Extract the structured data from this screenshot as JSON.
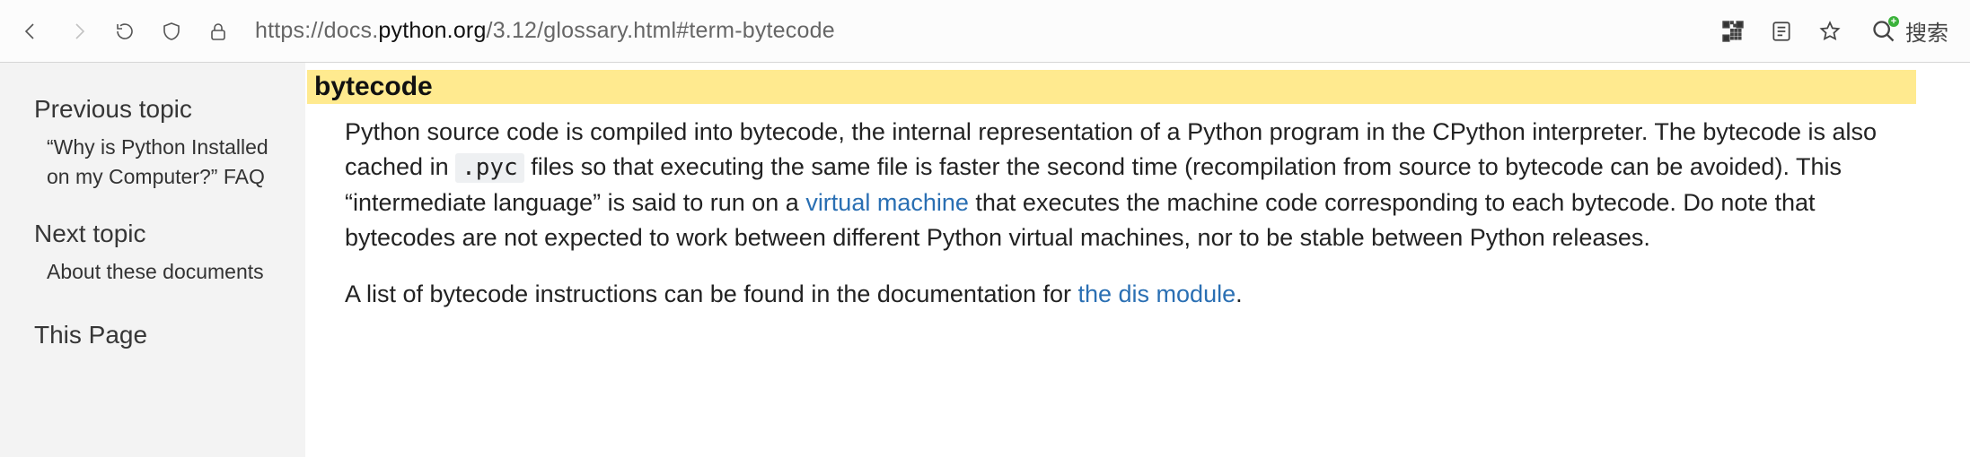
{
  "browser": {
    "url_prefix": "https://",
    "url_sub": "docs.",
    "url_domain": "python.org",
    "url_path": "/3.12/glossary.html#term-bytecode",
    "search_label": "搜索"
  },
  "sidebar": {
    "prev_heading": "Previous topic",
    "prev_link": "“Why is Python Installed on my Computer?” FAQ",
    "next_heading": "Next topic",
    "next_link": "About these documents",
    "this_page": "This Page"
  },
  "content": {
    "term": "bytecode",
    "para1_a": "Python source code is compiled into bytecode, the internal representation of a Python program in the CPython interpreter. The bytecode is also cached in ",
    "code1": ".pyc",
    "para1_b": " files so that executing the same file is faster the second time (recompilation from source to bytecode can be avoided). This “intermediate language” is said to run on a ",
    "link1": "virtual machine",
    "para1_c": " that executes the machine code corresponding to each bytecode. Do note that bytecodes are not expected to work between different Python virtual machines, nor to be stable between Python releases.",
    "para2_a": "A list of bytecode instructions can be found in the documentation for ",
    "link2": "the dis module",
    "para2_b": "."
  }
}
